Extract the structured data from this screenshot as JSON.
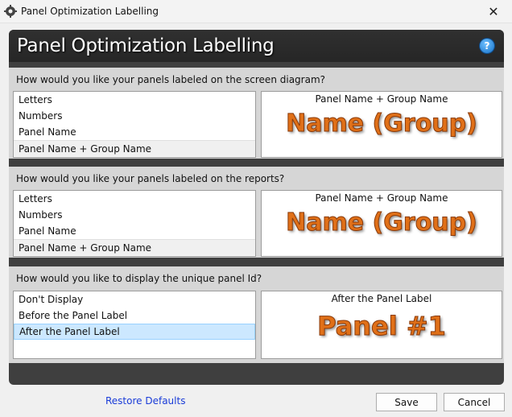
{
  "window": {
    "title": "Panel Optimization Labelling",
    "close_glyph": "✕"
  },
  "header": {
    "title": "Panel Optimization Labelling",
    "help_glyph": "?"
  },
  "sections": [
    {
      "question": "How would you like your panels labeled on the screen diagram?",
      "options": [
        "Letters",
        "Numbers",
        "Panel Name",
        "Panel Name + Group Name"
      ],
      "selected_index": 3,
      "preview_caption": "Panel Name + Group Name",
      "preview_text": "Name (Group)"
    },
    {
      "question": "How would you like your panels labeled on the reports?",
      "options": [
        "Letters",
        "Numbers",
        "Panel Name",
        "Panel Name + Group Name"
      ],
      "selected_index": 3,
      "preview_caption": "Panel Name + Group Name",
      "preview_text": "Name (Group)"
    },
    {
      "question": "How would you like to display the unique panel Id?",
      "options": [
        "Don't Display",
        "Before the Panel Label",
        "After the Panel Label"
      ],
      "selected_index": 2,
      "preview_caption": "After the Panel Label",
      "preview_text": "Panel #1"
    }
  ],
  "footer": {
    "restore_label": "Restore Defaults",
    "save_label": "Save",
    "cancel_label": "Cancel"
  },
  "colors": {
    "panel_bg": "#3f3f3f",
    "section_band": "#d6d6d6",
    "preview_text": "#e07018",
    "link": "#1a3cd8",
    "active_selection": "#cce8ff"
  }
}
